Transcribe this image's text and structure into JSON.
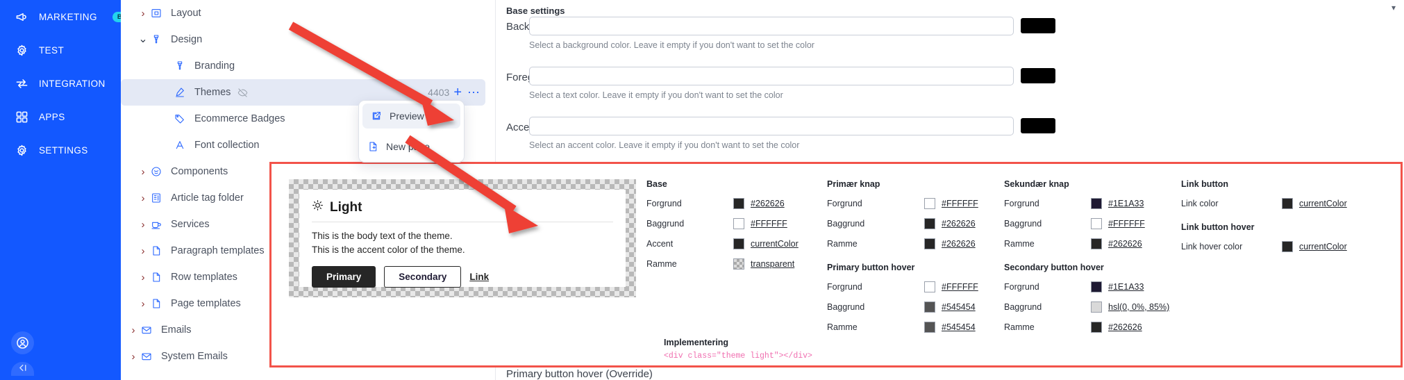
{
  "rail": {
    "items": [
      {
        "label": "MARKETING",
        "icon": "megaphone-icon",
        "badge": "BETA"
      },
      {
        "label": "TEST",
        "icon": "gear-icon",
        "badge": ""
      },
      {
        "label": "INTEGRATION",
        "icon": "transfer-arrows-icon",
        "badge": ""
      },
      {
        "label": "APPS",
        "icon": "grid-squares-icon",
        "badge": ""
      },
      {
        "label": "SETTINGS",
        "icon": "gear-icon",
        "badge": ""
      }
    ],
    "accent": "#1358ff",
    "badge_color": "#22d3ee"
  },
  "tree": {
    "items": [
      {
        "label": "Layout",
        "indent": 1,
        "chevron": "right",
        "icon": "layout-icon"
      },
      {
        "label": "Design",
        "indent": 1,
        "chevron": "down",
        "icon": "brush-icon"
      },
      {
        "label": "Branding",
        "indent": 2,
        "chevron": "none",
        "icon": "brush-icon"
      },
      {
        "label": "Themes",
        "indent": 2,
        "chevron": "none",
        "icon": "pencil-icon",
        "selected": true,
        "eye_off": true,
        "count": "4403",
        "plus": "+",
        "more": "⋯"
      },
      {
        "label": "Ecommerce Badges",
        "indent": 2,
        "chevron": "none",
        "icon": "tag-icon"
      },
      {
        "label": "Font collection",
        "indent": 2,
        "chevron": "none",
        "icon": "letter-a-icon"
      },
      {
        "label": "Components",
        "indent": 1,
        "chevron": "right",
        "icon": "puzzle-icon"
      },
      {
        "label": "Article tag folder",
        "indent": 1,
        "chevron": "right",
        "icon": "article-icon"
      },
      {
        "label": "Services",
        "indent": 1,
        "chevron": "right",
        "icon": "cup-icon"
      },
      {
        "label": "Paragraph templates",
        "indent": 1,
        "chevron": "right",
        "icon": "document-icon"
      },
      {
        "label": "Row templates",
        "indent": 1,
        "chevron": "right",
        "icon": "document-icon"
      },
      {
        "label": "Page templates",
        "indent": 1,
        "chevron": "right",
        "icon": "document-icon"
      },
      {
        "label": "Emails",
        "indent": 0,
        "chevron": "right",
        "icon": "envelope-icon"
      },
      {
        "label": "System Emails",
        "indent": 0,
        "chevron": "right",
        "icon": "envelope-icon"
      }
    ]
  },
  "context_menu": {
    "items": [
      {
        "label": "Preview",
        "icon": "external-link-icon",
        "highlighted": true
      },
      {
        "label": "New page",
        "icon": "new-document-icon",
        "highlighted": false
      }
    ]
  },
  "form": {
    "section_title": "Base settings",
    "fields": [
      {
        "label": "Background color",
        "value": "",
        "hint": "Select a background color. Leave it empty if you don't want to set the color",
        "swatch": "#000000"
      },
      {
        "label": "Foreground color",
        "value": "",
        "hint": "Select a text color. Leave it empty if you don't want to set the color",
        "swatch": "#000000"
      },
      {
        "label": "Accent color",
        "value": "",
        "hint": "Select an accent color. Leave it empty if you don't want to set the color",
        "swatch": "#000000"
      }
    ],
    "bottom_label": "Primary button hover (Override)"
  },
  "preview": {
    "title": "Light",
    "title_icon": "sun-icon",
    "body_line_1": "This is the body text of the theme.",
    "body_line_2": "This is the accent color of the theme.",
    "primary_button": "Primary",
    "secondary_button": "Secondary",
    "link_button": "Link"
  },
  "color_groups": [
    {
      "title": "Base",
      "rows": [
        {
          "label": "Forgrund",
          "swatch": "#262626",
          "value": "#262626"
        },
        {
          "label": "Baggrund",
          "swatch": "#FFFFFF",
          "value": "#FFFFFF"
        },
        {
          "label": "Accent",
          "swatch": "#262626",
          "value": "currentColor"
        },
        {
          "label": "Ramme",
          "swatch": "checker",
          "value": "transparent"
        }
      ]
    },
    {
      "title": "Primær knap",
      "rows": [
        {
          "label": "Forgrund",
          "swatch": "#FFFFFF",
          "value": "#FFFFFF"
        },
        {
          "label": "Baggrund",
          "swatch": "#262626",
          "value": "#262626"
        },
        {
          "label": "Ramme",
          "swatch": "#262626",
          "value": "#262626"
        }
      ],
      "subtitle": "Primary button hover",
      "subrows": [
        {
          "label": "Forgrund",
          "swatch": "#FFFFFF",
          "value": "#FFFFFF"
        },
        {
          "label": "Baggrund",
          "swatch": "#545454",
          "value": "#545454"
        },
        {
          "label": "Ramme",
          "swatch": "#545454",
          "value": "#545454"
        }
      ]
    },
    {
      "title": "Sekundær knap",
      "rows": [
        {
          "label": "Forgrund",
          "swatch": "#1E1A33",
          "value": "#1E1A33"
        },
        {
          "label": "Baggrund",
          "swatch": "#FFFFFF",
          "value": "#FFFFFF"
        },
        {
          "label": "Ramme",
          "swatch": "#262626",
          "value": "#262626"
        }
      ],
      "subtitle": "Secondary button hover",
      "subrows": [
        {
          "label": "Forgrund",
          "swatch": "#1E1A33",
          "value": "#1E1A33"
        },
        {
          "label": "Baggrund",
          "swatch": "#D9D9D9",
          "value": "hsl(0, 0%, 85%)"
        },
        {
          "label": "Ramme",
          "swatch": "#262626",
          "value": "#262626"
        }
      ]
    },
    {
      "title": "Link button",
      "rows": [
        {
          "label": "Link color",
          "swatch": "#262626",
          "value": "currentColor"
        }
      ],
      "subtitle": "Link button hover",
      "subrows": [
        {
          "label": "Link hover color",
          "swatch": "#262626",
          "value": "currentColor"
        }
      ]
    }
  ],
  "implementation": {
    "title": "Implementering",
    "code": "<div class=\"theme light\"></div>"
  },
  "annotations": {
    "highlight_color": "#f2534a",
    "arrow_color": "#ee4136"
  }
}
